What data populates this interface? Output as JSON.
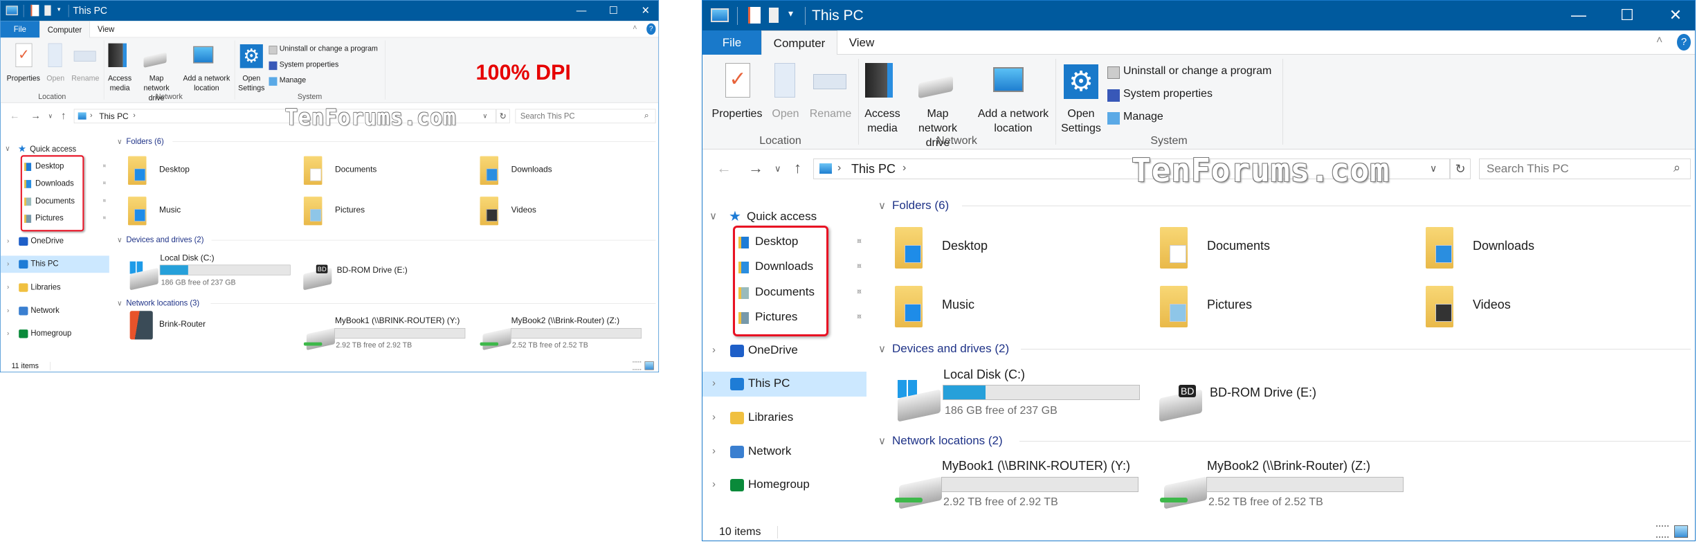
{
  "watermark": "TenForums.com",
  "colors": {
    "titlebar": "#005a9e",
    "file_tab": "#1979ca",
    "selection": "#cce8ff",
    "highlight_box": "#e81123",
    "header_text": "#1e3287",
    "disk_fill": "#26a0da"
  },
  "windows": [
    {
      "title": "This PC",
      "dpi_label": "100% DPI",
      "tabs": {
        "file": "File",
        "computer": "Computer",
        "view": "View"
      },
      "ribbon": {
        "properties": "Properties",
        "open": "Open",
        "rename": "Rename",
        "location_group": "Location",
        "access_media": "Access media",
        "map_drive": "Map network drive",
        "add_location": "Add a network location",
        "network_group": "Network",
        "open_settings": "Open Settings",
        "uninstall": "Uninstall or change a program",
        "system_properties": "System properties",
        "manage": "Manage",
        "system_group": "System"
      },
      "address": {
        "path": "This PC",
        "search_placeholder": "Search This PC"
      },
      "nav": {
        "quick_access": "Quick access",
        "pinned": [
          "Desktop",
          "Downloads",
          "Documents",
          "Pictures"
        ],
        "items": [
          "OneDrive",
          "This PC",
          "Libraries",
          "Network",
          "Homegroup"
        ]
      },
      "folders_header": "Folders (6)",
      "folders": [
        "Desktop",
        "Documents",
        "Downloads",
        "Music",
        "Pictures",
        "Videos"
      ],
      "devices_header": "Devices and drives (2)",
      "drives": [
        {
          "name": "Local Disk (C:)",
          "free": "186 GB free of 237 GB",
          "used_fraction": 0.215
        },
        {
          "name": "BD-ROM Drive (E:)"
        }
      ],
      "network_header": "Network locations (3)",
      "network": [
        {
          "name": "Brink-Router"
        },
        {
          "name": "MyBook1 (\\\\BRINK-ROUTER) (Y:)",
          "free": "2.92 TB free of 2.92 TB",
          "used_fraction": 0
        },
        {
          "name": "MyBook2 (\\\\Brink-Router) (Z:)",
          "free": "2.52 TB free of 2.52 TB",
          "used_fraction": 0
        }
      ],
      "status": "11 items"
    },
    {
      "title": "This PC",
      "tabs": {
        "file": "File",
        "computer": "Computer",
        "view": "View"
      },
      "ribbon": {
        "properties": "Properties",
        "open": "Open",
        "rename": "Rename",
        "location_group": "Location",
        "access_media": "Access media",
        "map_drive": "Map network drive",
        "add_location": "Add a network location",
        "network_group": "Network",
        "open_settings": "Open Settings",
        "uninstall": "Uninstall or change a program",
        "system_properties": "System properties",
        "manage": "Manage",
        "system_group": "System"
      },
      "address": {
        "path": "This PC",
        "search_placeholder": "Search This PC"
      },
      "nav": {
        "quick_access": "Quick access",
        "pinned": [
          "Desktop",
          "Downloads",
          "Documents",
          "Pictures"
        ],
        "items": [
          "OneDrive",
          "This PC",
          "Libraries",
          "Network",
          "Homegroup"
        ]
      },
      "folders_header": "Folders (6)",
      "folders": [
        "Desktop",
        "Documents",
        "Downloads",
        "Music",
        "Pictures",
        "Videos"
      ],
      "devices_header": "Devices and drives (2)",
      "drives": [
        {
          "name": "Local Disk (C:)",
          "free": "186 GB free of 237 GB",
          "used_fraction": 0.215
        },
        {
          "name": "BD-ROM Drive (E:)"
        }
      ],
      "network_header": "Network locations (2)",
      "network": [
        {
          "name": "MyBook1 (\\\\BRINK-ROUTER) (Y:)",
          "free": "2.92 TB free of 2.92 TB",
          "used_fraction": 0
        },
        {
          "name": "MyBook2 (\\\\Brink-Router) (Z:)",
          "free": "2.52 TB free of 2.52 TB",
          "used_fraction": 0
        }
      ],
      "status": "10 items"
    }
  ]
}
